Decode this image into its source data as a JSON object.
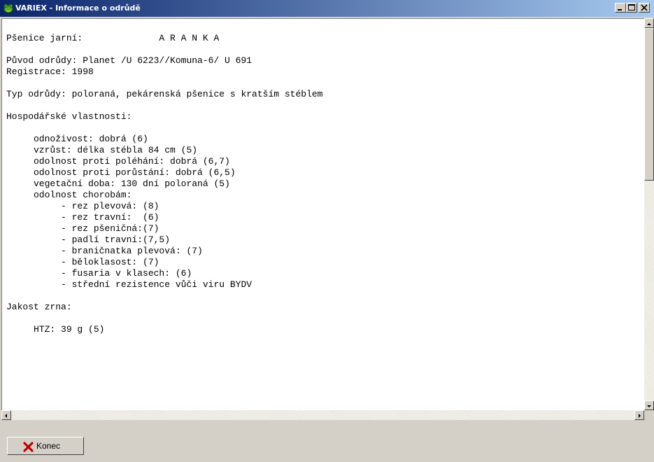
{
  "window": {
    "title": "VARIEX - Informace o odrůdě",
    "icon": "frog-app-icon",
    "controls": [
      "minimize-icon",
      "maximize-icon",
      "close-icon"
    ]
  },
  "document": {
    "lines": [
      "",
      "Pšenice jarní:              A R A N K A",
      "",
      "Původ odrůdy: Planet /U 6223//Komuna-6/ U 691",
      "Registrace: 1998",
      "",
      "Typ odrůdy: poloraná, pekárenská pšenice s kratším stéblem",
      "",
      "Hospodářské vlastnosti:",
      "",
      "     odnoživost: dobrá (6)",
      "     vzrůst: délka stébla 84 cm (5)",
      "     odolnost proti poléhání: dobrá (6,7)",
      "     odolnost proti porůstání: dobrá (6,5)",
      "     vegetační doba: 130 dní poloraná (5)",
      "     odolnost chorobám:",
      "          - rez plevová: (8)",
      "          - rez travní:  (6)",
      "          - rez pšeničná:(7)",
      "          - padlí travní:(7,5)",
      "          - braničnatka plevová: (7)",
      "          - běloklasost: (7)",
      "          - fusaria v klasech: (6)",
      "          - střední rezistence vůči viru BYDV",
      "",
      "Jakost zrna:",
      "",
      "     HTZ: 39 g (5)"
    ]
  },
  "footer": {
    "close_button_label": "Konec",
    "close_button_icon": "red-x-icon"
  },
  "colors": {
    "titlebar_start": "#0a246a",
    "titlebar_end": "#a6caf0",
    "window_bg": "#d4d0c8",
    "close_icon": "#c00000"
  }
}
